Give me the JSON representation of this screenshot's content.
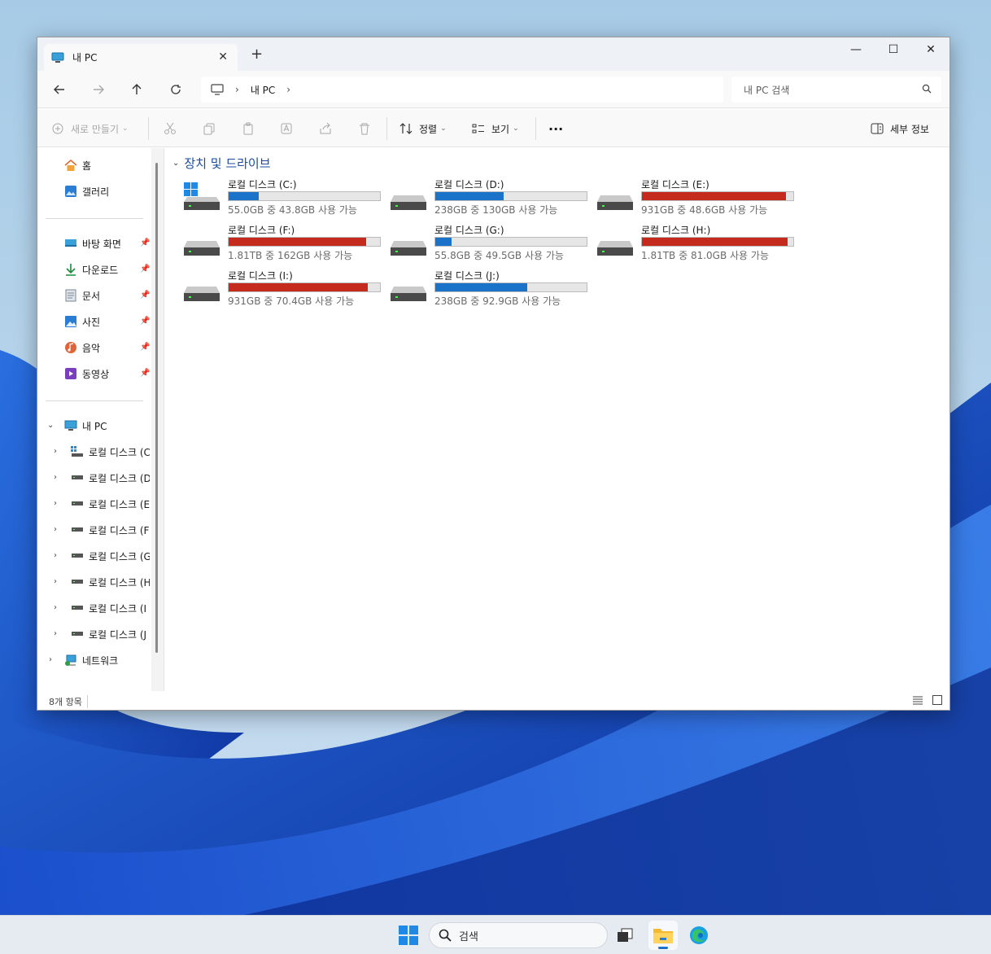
{
  "window": {
    "tab_title": "내 PC",
    "tab_close": "✕",
    "new_tab": "+",
    "controls": {
      "minimize": "—",
      "maximize": "☐",
      "close": "✕"
    }
  },
  "navbar": {
    "address_segments": [
      "내 PC"
    ],
    "search_placeholder": "내 PC 검색"
  },
  "toolbar": {
    "new_label": "새로 만들기",
    "sort_label": "정렬",
    "view_label": "보기",
    "more_label": "···",
    "details_label": "세부 정보"
  },
  "sidebar": {
    "quick": [
      {
        "label": "홈",
        "icon": "home-icon"
      },
      {
        "label": "갤러리",
        "icon": "gallery-icon"
      }
    ],
    "pinned": [
      {
        "label": "바탕 화면",
        "icon": "desktop-icon"
      },
      {
        "label": "다운로드",
        "icon": "download-icon"
      },
      {
        "label": "문서",
        "icon": "document-icon"
      },
      {
        "label": "사진",
        "icon": "pictures-icon"
      },
      {
        "label": "음악",
        "icon": "music-icon"
      },
      {
        "label": "동영상",
        "icon": "video-icon"
      }
    ],
    "this_pc": "내 PC",
    "drives": [
      "로컬 디스크 (C",
      "로컬 디스크 (D",
      "로컬 디스크 (E",
      "로컬 디스크 (F",
      "로컬 디스크 (G",
      "로컬 디스크 (H",
      "로컬 디스크 (I",
      "로컬 디스크 (J"
    ],
    "network": "네트워크"
  },
  "content": {
    "section_title": "장치 및 드라이브",
    "drives": [
      {
        "name": "로컬 디스크 (C:)",
        "info": "55.0GB 중 43.8GB 사용 가능",
        "used_fraction": 0.2,
        "color": "#1a73c8",
        "system": true
      },
      {
        "name": "로컬 디스크 (D:)",
        "info": "238GB 중 130GB 사용 가능",
        "used_fraction": 0.45,
        "color": "#1a73c8",
        "system": false
      },
      {
        "name": "로컬 디스크 (E:)",
        "info": "931GB 중 48.6GB 사용 가능",
        "used_fraction": 0.95,
        "color": "#c42b1c",
        "system": false
      },
      {
        "name": "로컬 디스크 (F:)",
        "info": "1.81TB 중 162GB 사용 가능",
        "used_fraction": 0.91,
        "color": "#c42b1c",
        "system": false
      },
      {
        "name": "로컬 디스크 (G:)",
        "info": "55.8GB 중 49.5GB 사용 가능",
        "used_fraction": 0.11,
        "color": "#1a73c8",
        "system": false
      },
      {
        "name": "로컬 디스크 (H:)",
        "info": "1.81TB 중 81.0GB 사용 가능",
        "used_fraction": 0.96,
        "color": "#c42b1c",
        "system": false
      },
      {
        "name": "로컬 디스크 (I:)",
        "info": "931GB 중 70.4GB 사용 가능",
        "used_fraction": 0.92,
        "color": "#c42b1c",
        "system": false
      },
      {
        "name": "로컬 디스크 (J:)",
        "info": "238GB 중 92.9GB 사용 가능",
        "used_fraction": 0.61,
        "color": "#1a73c8",
        "system": false
      }
    ]
  },
  "statusbar": {
    "item_count": "8개 항목"
  },
  "taskbar": {
    "search_label": "검색"
  }
}
